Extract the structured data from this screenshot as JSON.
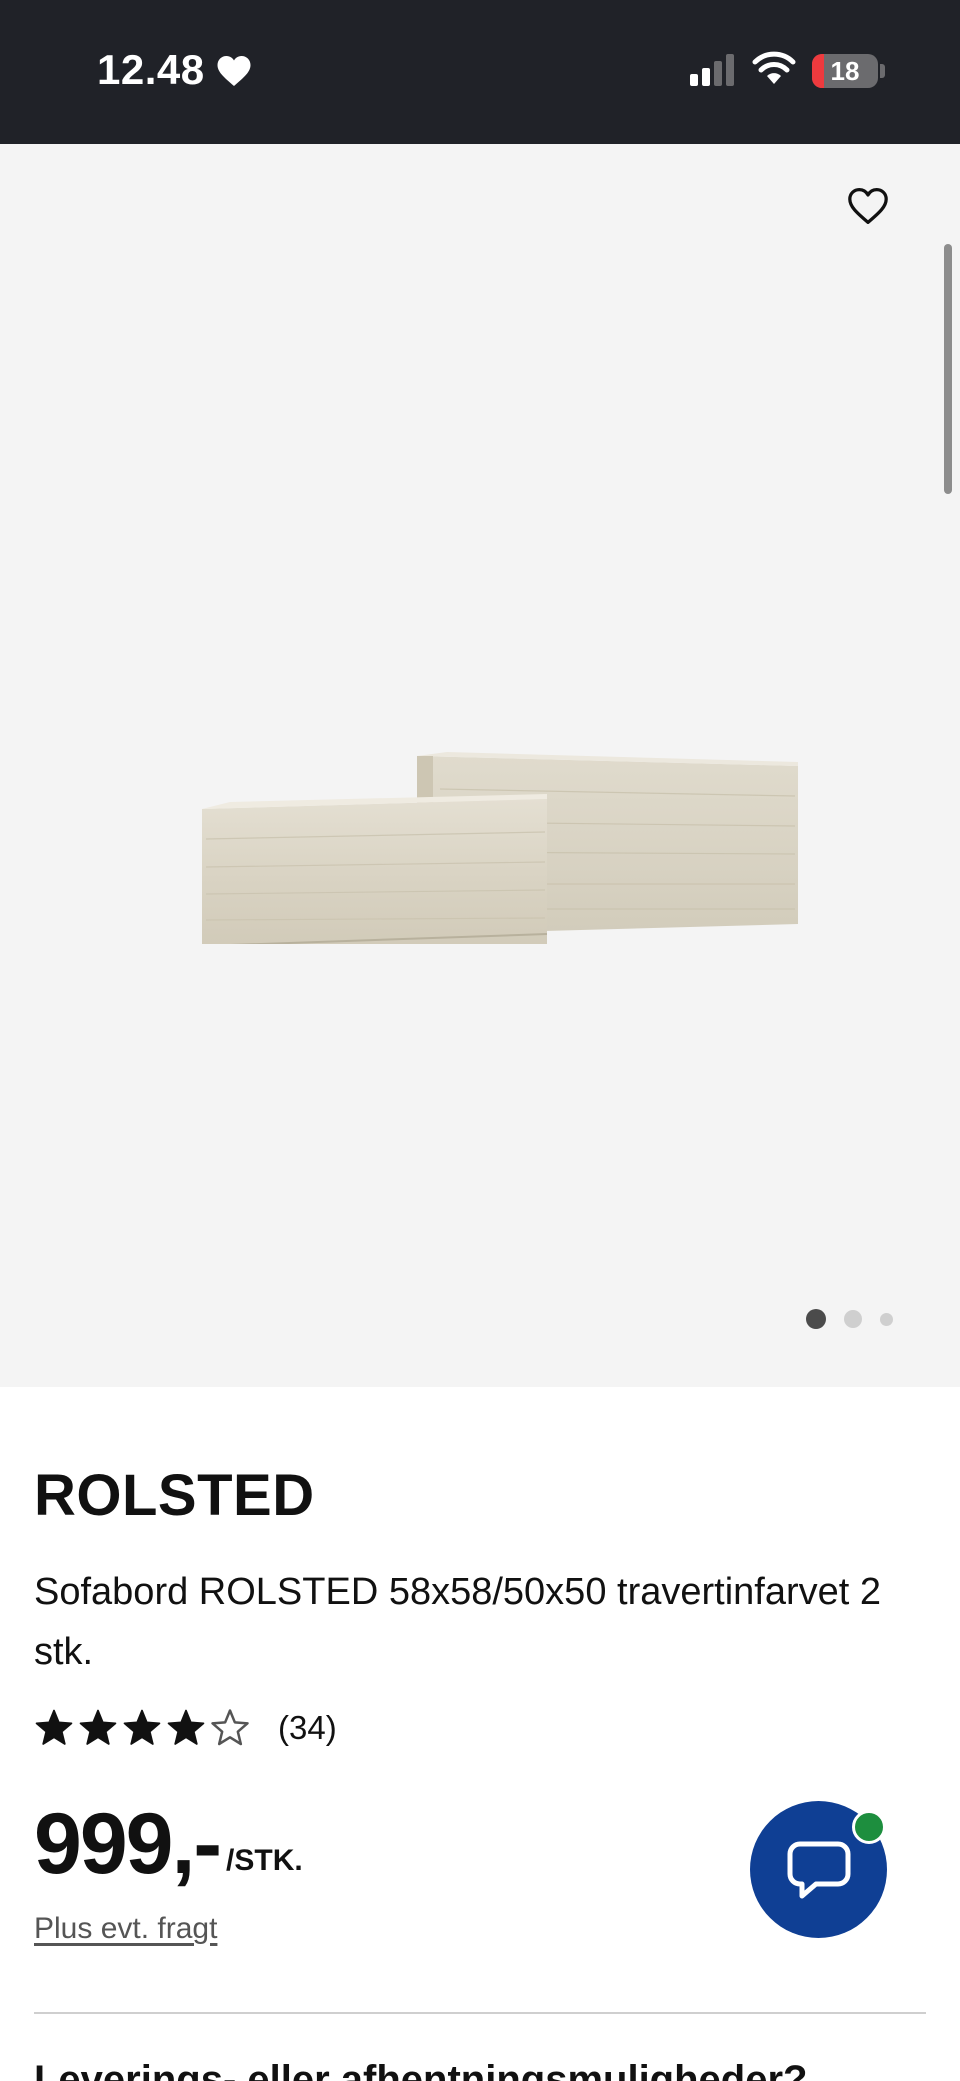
{
  "status_bar": {
    "time": "12.48",
    "battery_level": "18",
    "battery_fraction": 0.18,
    "icons": [
      "heart-icon",
      "cellular-signal-icon",
      "wifi-icon",
      "battery-icon"
    ]
  },
  "gallery": {
    "favorite_icon": "heart-outline-icon",
    "image_alt": "ROLSTED sofabord 2 stk.",
    "image_count": 3,
    "active_image": 1
  },
  "product": {
    "name": "ROLSTED",
    "description": "Sofabord ROLSTED 58x58/50x50 travertinfarvet 2 stk.",
    "rating_stars": 4,
    "rating_max": 5,
    "rating_count": "(34)",
    "price": "999,-",
    "price_unit": "/STK.",
    "shipping_note": "Plus evt. fragt"
  },
  "chat": {
    "icon": "chat-bubble-icon",
    "online": true
  },
  "next_section": {
    "heading": "Leverings- eller afhentningsmuligheder?"
  },
  "colors": {
    "status_bar_bg": "#202228",
    "gallery_bg": "#f4f4f4",
    "chat_button": "#0f3f94",
    "online_indicator": "#1d8e3e",
    "battery_low": "#ee3a3e"
  }
}
